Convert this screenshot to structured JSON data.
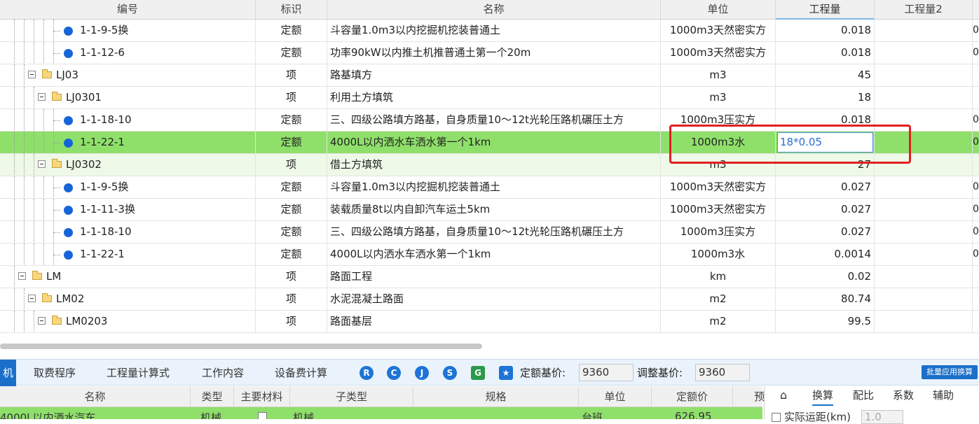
{
  "columns": {
    "code": "编号",
    "flag": "标识",
    "name": "名称",
    "unit": "单位",
    "qty": "工程量",
    "qty2": "工程量2"
  },
  "rows": [
    {
      "level": 5,
      "type": "item",
      "code": "1-1-9-5换",
      "flag": "定额",
      "name": "斗容量1.0m3以内挖掘机挖装普通土",
      "unit": "1000m3天然密实方",
      "qty": "0.018",
      "edge": "0"
    },
    {
      "level": 5,
      "type": "item",
      "code": "1-1-12-6",
      "flag": "定额",
      "name": "功率90kW以内推土机推普通土第一个20m",
      "unit": "1000m3天然密实方",
      "qty": "0.018",
      "edge": "0"
    },
    {
      "level": 3,
      "type": "group",
      "code": "LJ03",
      "flag": "项",
      "name": "路基填方",
      "unit": "m3",
      "qty": "45",
      "edge": ""
    },
    {
      "level": 4,
      "type": "group",
      "code": "LJ0301",
      "flag": "项",
      "name": "利用土方填筑",
      "unit": "m3",
      "qty": "18",
      "edge": ""
    },
    {
      "level": 5,
      "type": "item",
      "code": "1-1-18-10",
      "flag": "定额",
      "name": "三、四级公路填方路基，自身质量10～12t光轮压路机碾压土方",
      "unit": "1000m3压实方",
      "qty": "0.018",
      "edge": "0"
    },
    {
      "level": 5,
      "type": "item",
      "code": "1-1-22-1",
      "flag": "定额",
      "name": "4000L以内洒水车洒水第一个1km",
      "unit": "1000m3水",
      "qty": "",
      "edge": "0",
      "selected": true,
      "editValue": "18*0.05"
    },
    {
      "level": 4,
      "type": "group",
      "code": "LJ0302",
      "flag": "项",
      "name": "借土方填筑",
      "unit": "m3",
      "qty": "27",
      "edge": "",
      "sub": true
    },
    {
      "level": 5,
      "type": "item",
      "code": "1-1-9-5换",
      "flag": "定额",
      "name": "斗容量1.0m3以内挖掘机挖装普通土",
      "unit": "1000m3天然密实方",
      "qty": "0.027",
      "edge": "0"
    },
    {
      "level": 5,
      "type": "item",
      "code": "1-1-11-3换",
      "flag": "定额",
      "name": "装载质量8t以内自卸汽车运土5km",
      "unit": "1000m3天然密实方",
      "qty": "0.027",
      "edge": "0"
    },
    {
      "level": 5,
      "type": "item",
      "code": "1-1-18-10",
      "flag": "定额",
      "name": "三、四级公路填方路基，自身质量10～12t光轮压路机碾压土方",
      "unit": "1000m3压实方",
      "qty": "0.027",
      "edge": "0"
    },
    {
      "level": 5,
      "type": "item",
      "code": "1-1-22-1",
      "flag": "定额",
      "name": "4000L以内洒水车洒水第一个1km",
      "unit": "1000m3水",
      "qty": "0.0014",
      "edge": "0"
    },
    {
      "level": 2,
      "type": "group",
      "code": "LM",
      "flag": "项",
      "name": "路面工程",
      "unit": "km",
      "qty": "0.02",
      "edge": ""
    },
    {
      "level": 3,
      "type": "group",
      "code": "LM02",
      "flag": "项",
      "name": "水泥混凝土路面",
      "unit": "m2",
      "qty": "80.74",
      "edge": ""
    },
    {
      "level": 4,
      "type": "group",
      "code": "LM0203",
      "flag": "项",
      "name": "路面基层",
      "unit": "m2",
      "qty": "99.5",
      "edge": ""
    }
  ],
  "toolbar": {
    "first_tab": "机",
    "tabs": [
      "取费程序",
      "工程量计算式",
      "工作内容",
      "设备费计算"
    ],
    "icons": [
      "R",
      "C",
      "J",
      "S",
      "G"
    ],
    "base_price_label": "定额基价:",
    "base_price_value": "9360",
    "adjusted_price_label": "调整基价:",
    "adjusted_price_value": "9360",
    "batch_button": "批量应用换算"
  },
  "bottom": {
    "columns": [
      "名称",
      "类型",
      "主要材料",
      "子类型",
      "规格",
      "单位",
      "定额价",
      "预"
    ],
    "row": {
      "name": "4000L以内洒水汽车",
      "type": "机械",
      "subtype": "机械",
      "unit": "台班",
      "price": "626.95"
    }
  },
  "side_panel": {
    "tabs": [
      "换算",
      "配比",
      "系数",
      "辅助"
    ],
    "option_label": "实际运距(km)",
    "option_value": "1.0"
  }
}
